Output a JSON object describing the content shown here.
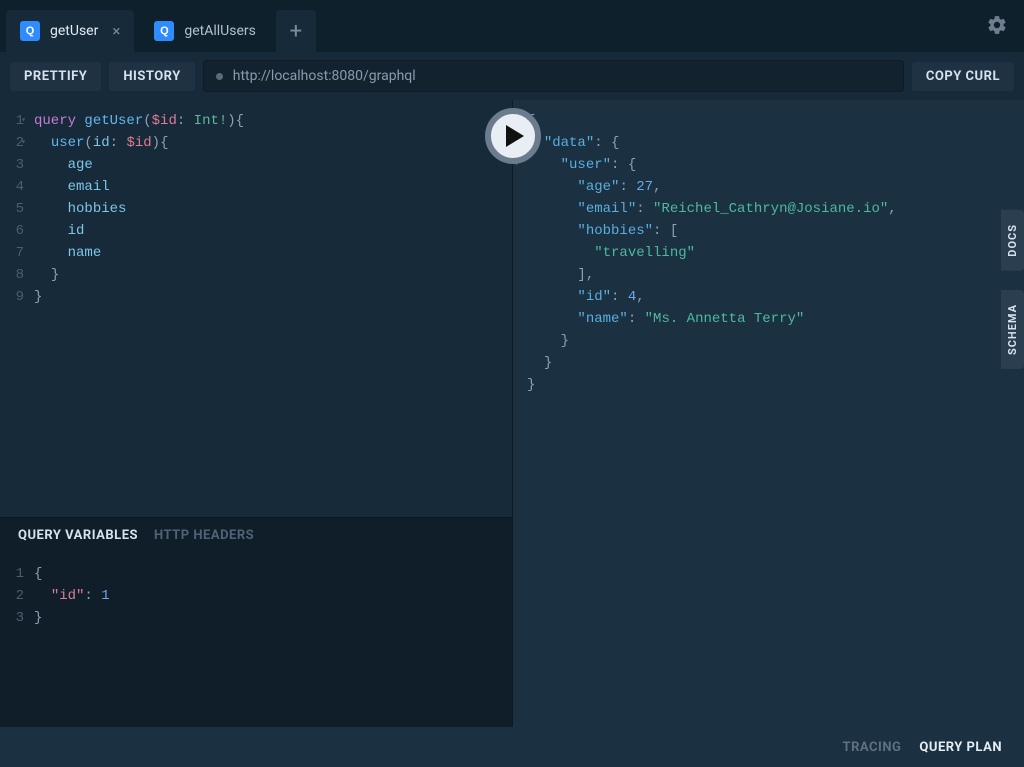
{
  "tabs": [
    {
      "label": "getUser",
      "active": true
    },
    {
      "label": "getAllUsers",
      "active": false
    }
  ],
  "tab_icon_letter": "Q",
  "toolbar": {
    "prettify": "PRETTIFY",
    "history": "HISTORY",
    "copy_curl": "COPY CURL",
    "url": "http://localhost:8080/graphql"
  },
  "query": {
    "lines": [
      "1",
      "2",
      "3",
      "4",
      "5",
      "6",
      "7",
      "8",
      "9"
    ],
    "line1": {
      "kw": "query",
      "fn": "getUser",
      "var": "$id",
      "type": "Int!"
    },
    "line2": {
      "fn": "user",
      "arg": "id",
      "var": "$id"
    },
    "fields": {
      "age": "age",
      "email": "email",
      "hobbies": "hobbies",
      "id": "id",
      "name": "name"
    }
  },
  "response": {
    "data_key": "\"data\"",
    "user_key": "\"user\"",
    "age_key": "\"age\"",
    "age_val": "27",
    "email_key": "\"email\"",
    "email_val": "\"Reichel_Cathryn@Josiane.io\"",
    "hobbies_key": "\"hobbies\"",
    "hobbies_item": "\"travelling\"",
    "id_key": "\"id\"",
    "id_val": "4",
    "name_key": "\"name\"",
    "name_val": "\"Ms. Annetta Terry\""
  },
  "variables_section": {
    "tab_vars": "QUERY VARIABLES",
    "tab_headers": "HTTP HEADERS",
    "lines": [
      "1",
      "2",
      "3"
    ],
    "id_key": "\"id\"",
    "id_val": "1"
  },
  "side": {
    "docs": "DOCS",
    "schema": "SCHEMA"
  },
  "footer": {
    "tracing": "TRACING",
    "query_plan": "QUERY PLAN"
  }
}
